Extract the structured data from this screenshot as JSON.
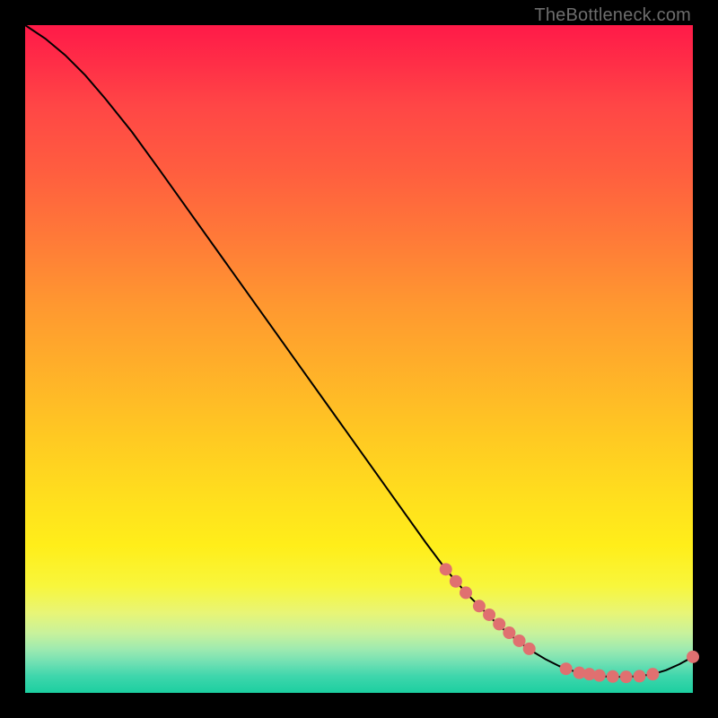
{
  "watermark": "TheBottleneck.com",
  "colors": {
    "background": "#000000",
    "curve_stroke": "#000000",
    "dot_fill": "#e07070",
    "gradient_top": "#ff1a48",
    "gradient_bottom": "#1bcfa0"
  },
  "chart_data": {
    "type": "line",
    "title": "",
    "xlabel": "",
    "ylabel": "",
    "xlim": [
      0,
      100
    ],
    "ylim": [
      0,
      100
    ],
    "grid": false,
    "series": [
      {
        "name": "bottleneck-curve",
        "x": [
          0,
          3,
          6,
          9,
          12,
          16,
          20,
          25,
          30,
          35,
          40,
          45,
          50,
          55,
          60,
          63,
          66,
          68,
          70,
          72,
          74,
          76,
          78,
          80,
          82,
          84,
          86,
          88,
          90,
          92,
          94,
          96,
          98,
          100
        ],
        "y": [
          100,
          98,
          95.5,
          92.5,
          89,
          84,
          78.5,
          71.5,
          64.5,
          57.5,
          50.5,
          43.5,
          36.5,
          29.5,
          22.5,
          18.5,
          15,
          13,
          11,
          9.2,
          7.6,
          6.2,
          5,
          4,
          3.3,
          2.8,
          2.5,
          2.4,
          2.4,
          2.5,
          2.8,
          3.4,
          4.3,
          5.4
        ]
      }
    ],
    "dot_clusters": [
      {
        "name": "upper-band",
        "points": [
          {
            "x": 63,
            "y": 18.5
          },
          {
            "x": 64.5,
            "y": 16.7
          },
          {
            "x": 66,
            "y": 15
          },
          {
            "x": 68,
            "y": 13
          },
          {
            "x": 69.5,
            "y": 11.7
          },
          {
            "x": 71,
            "y": 10.3
          },
          {
            "x": 72.5,
            "y": 9
          },
          {
            "x": 74,
            "y": 7.8
          },
          {
            "x": 75.5,
            "y": 6.6
          }
        ]
      },
      {
        "name": "bottom-band",
        "points": [
          {
            "x": 81,
            "y": 3.6
          },
          {
            "x": 83,
            "y": 3.0
          },
          {
            "x": 84.5,
            "y": 2.8
          },
          {
            "x": 86,
            "y": 2.6
          },
          {
            "x": 88,
            "y": 2.45
          },
          {
            "x": 90,
            "y": 2.4
          },
          {
            "x": 92,
            "y": 2.5
          },
          {
            "x": 94,
            "y": 2.8
          }
        ]
      },
      {
        "name": "tail",
        "points": [
          {
            "x": 100,
            "y": 5.4
          }
        ]
      }
    ],
    "dot_radius_px": 7
  }
}
